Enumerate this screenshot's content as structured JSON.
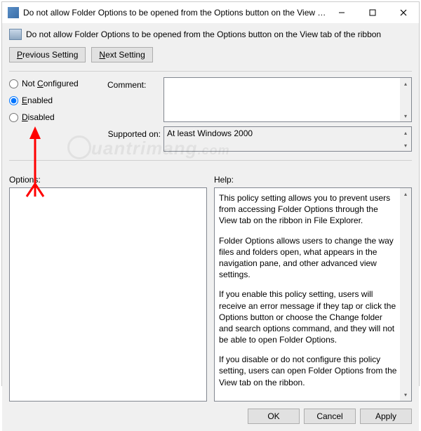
{
  "title": "Do not allow Folder Options to be opened from the Options button on the View tab of the ribbon",
  "policyName": "Do not allow Folder Options to be opened from the Options button on the View tab of the ribbon",
  "nav": {
    "previous": "Previous Setting",
    "next": "Next Setting"
  },
  "radios": {
    "notConfigured": "Not Configured",
    "enabled": "Enabled",
    "disabled": "Disabled",
    "selected": "enabled"
  },
  "labels": {
    "comment": "Comment:",
    "supportedOn": "Supported on:",
    "options": "Options:",
    "help": "Help:"
  },
  "commentValue": "",
  "supportedValue": "At least Windows 2000",
  "help": {
    "p1": "This policy setting allows you to prevent users from accessing Folder Options through the View tab on the ribbon in File Explorer.",
    "p2": "Folder Options allows users to change the way files and folders open, what appears in the navigation pane, and other advanced view settings.",
    "p3": "If you enable this policy setting, users will receive an error message if they tap or click the Options button or choose the Change folder and search options command, and they will not be able to open Folder Options.",
    "p4": "If you disable or do not configure this policy setting, users can open Folder Options from the View tab on the ribbon."
  },
  "buttons": {
    "ok": "OK",
    "cancel": "Cancel",
    "apply": "Apply"
  },
  "watermark": "uantrimang"
}
